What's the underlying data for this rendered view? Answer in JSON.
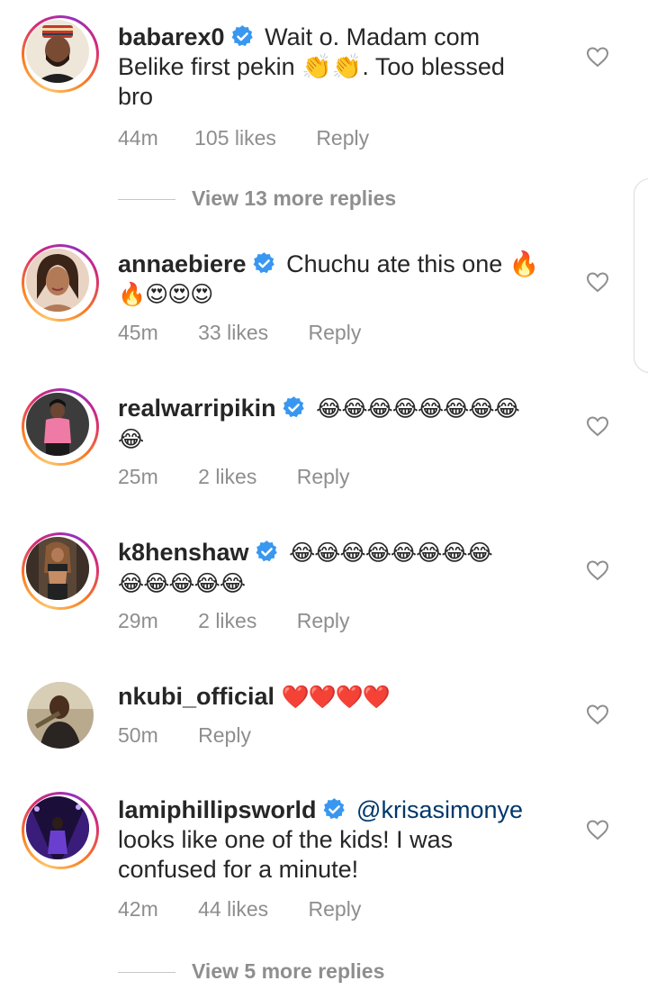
{
  "comments": [
    {
      "username": "babarex0",
      "verified": true,
      "text_line1": "Wait o.  Madam com",
      "text_line2": "Belike first pekin 👏👏. Too blessed",
      "text_line3": "bro",
      "time": "44m",
      "likes": "105 likes",
      "reply": "Reply",
      "view_replies": "View 13 more replies"
    },
    {
      "username": "annaebiere",
      "verified": true,
      "text_line1": "Chuchu ate this one 🔥",
      "text_line2": "🔥😍😍😍",
      "time": "45m",
      "likes": "33 likes",
      "reply": "Reply"
    },
    {
      "username": "realwarripikin",
      "verified": true,
      "text_line1": "😂😂😂😂😂😂😂😂",
      "text_line2": "😂",
      "time": "25m",
      "likes": "2 likes",
      "reply": "Reply"
    },
    {
      "username": "k8henshaw",
      "verified": true,
      "text_line1": "😂😂😂😂😂😂😂😂",
      "text_line2": "😂😂😂😂😂",
      "time": "29m",
      "likes": "2 likes",
      "reply": "Reply"
    },
    {
      "username": "nkubi_official",
      "verified": false,
      "text_line1": "❤️❤️❤️❤️",
      "time": "50m",
      "reply": "Reply"
    },
    {
      "username": "lamiphillipsworld",
      "verified": true,
      "mention": "@krisasimonye",
      "text_line2": "looks like one of the kids! I was",
      "text_line3": "confused for a minute!",
      "time": "42m",
      "likes": "44 likes",
      "reply": "Reply",
      "view_replies": "View 5 more replies"
    }
  ],
  "icons": {
    "like": "heart-outline-icon",
    "verified": "verified-badge-icon"
  },
  "colors": {
    "text": "#262626",
    "secondary": "#8e8e8e",
    "verified": "#3897f0",
    "mention": "#00376b"
  }
}
